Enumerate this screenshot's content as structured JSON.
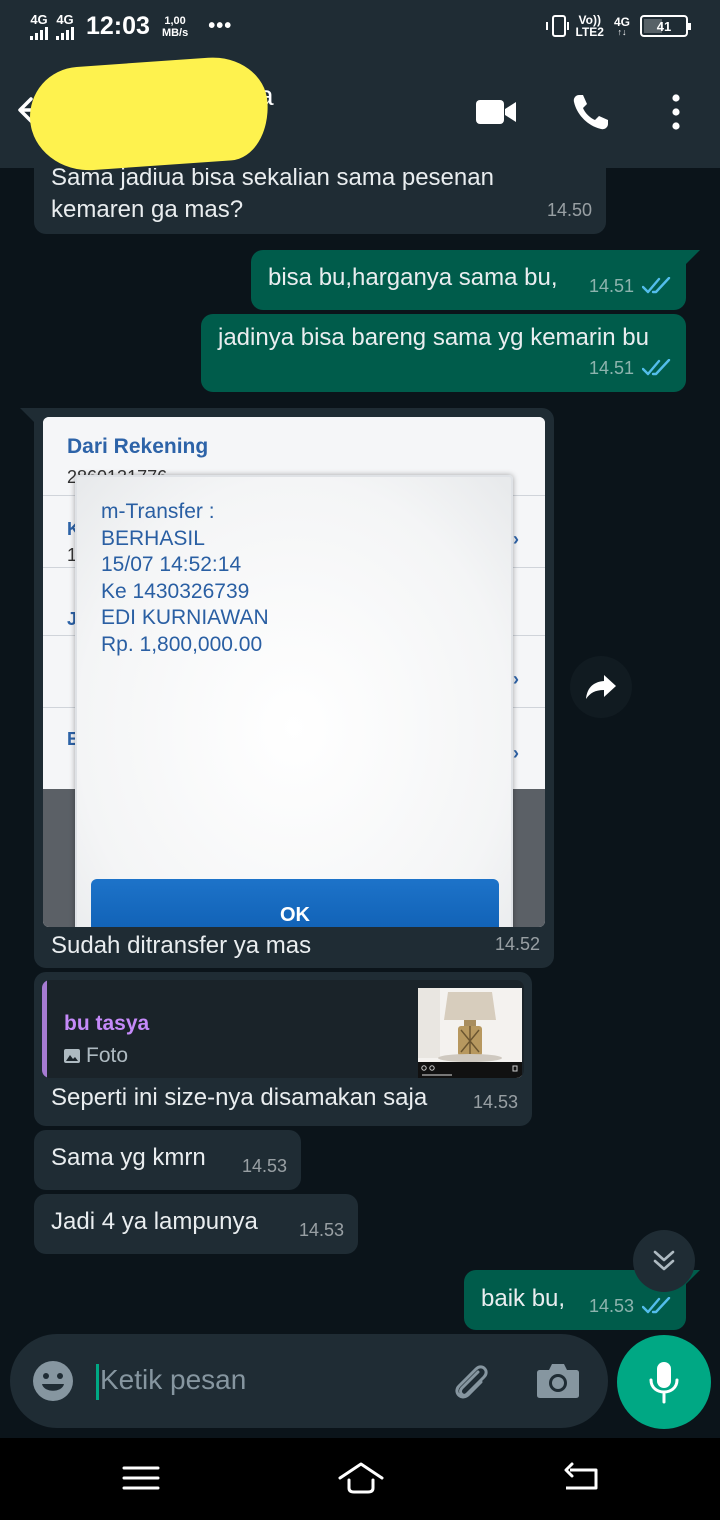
{
  "status_bar": {
    "sim1": "4G",
    "sim2": "4G",
    "time": "12:03",
    "speed_value": "1,00",
    "speed_unit": "MB/s",
    "overflow": "•••",
    "volte_top": "Vo))",
    "volte_bottom": "LTE2",
    "network": "4G",
    "network_sub": "↑↓",
    "battery": "41"
  },
  "header": {
    "contact_name_visible": "a",
    "icons": [
      "back-arrow-icon",
      "video-call-icon",
      "voice-call-icon",
      "more-vertical-icon"
    ]
  },
  "messages": [
    {
      "direction": "in",
      "text": "Sama jadiua bisa sekalian sama pesenan kemaren ga mas?",
      "time": "14.50"
    },
    {
      "direction": "out",
      "text": "bisa bu,harganya sama bu,",
      "time": "14.51",
      "status": "read"
    },
    {
      "direction": "out",
      "text": "jadinya bisa bareng sama yg kemarin bu",
      "time": "14.51",
      "status": "read"
    },
    {
      "direction": "in",
      "type": "image",
      "caption": "Sudah ditransfer ya mas",
      "time": "14.52",
      "image": {
        "background_title": "Dari Rekening",
        "background_account": "2860131776",
        "background_row_letters": [
          "K",
          "1",
          "J",
          "E"
        ],
        "dialog_lines": [
          "m-Transfer :",
          "BERHASIL",
          "15/07 14:52:14",
          "Ke 1430326739",
          "EDI KURNIAWAN",
          "Rp. 1,800,000.00"
        ],
        "dialog_button": "OK"
      }
    },
    {
      "direction": "in",
      "type": "reply",
      "quote_author": "bu tasya",
      "quote_type": "Foto",
      "text": "Seperti ini size-nya disamakan saja",
      "time": "14.53"
    },
    {
      "direction": "in",
      "text": "Sama yg kmrn",
      "time": "14.53"
    },
    {
      "direction": "in",
      "text": "Jadi 4 ya lampunya",
      "time": "14.53"
    },
    {
      "direction": "out",
      "text": "baik bu,",
      "time": "14.53",
      "status": "read"
    }
  ],
  "input": {
    "placeholder": "Ketik pesan",
    "value": ""
  },
  "colors": {
    "background": "#0b141a",
    "bar": "#1f2c34",
    "incoming": "#1f2c34",
    "outgoing": "#005c4b",
    "accent": "#00a884",
    "read_tick": "#53bdeb",
    "quote_author": "#c58af9",
    "redaction": "#fef24e"
  }
}
